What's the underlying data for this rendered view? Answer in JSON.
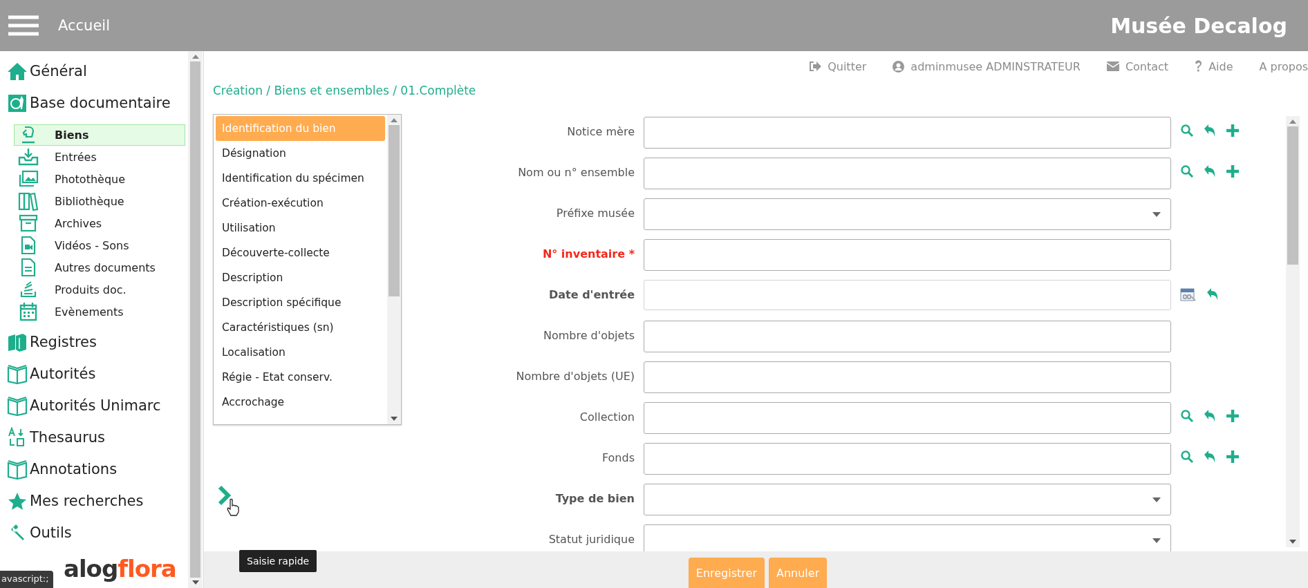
{
  "header": {
    "title": "Accueil",
    "brand": "Musée Decalog"
  },
  "top_links": [
    {
      "kind": "logout",
      "label": "Quitter"
    },
    {
      "kind": "user",
      "label": "adminmusee ADMINSTRATEUR"
    },
    {
      "kind": "mail",
      "label": "Contact"
    },
    {
      "kind": "help",
      "label": "Aide"
    },
    {
      "kind": "plain",
      "label": "A propos"
    }
  ],
  "sidebar": {
    "items": [
      {
        "label": "Général",
        "selected": false
      },
      {
        "label": "Base documentaire",
        "selected": false,
        "children": [
          {
            "label": "Biens",
            "selected": true
          },
          {
            "label": "Entrées",
            "selected": false
          },
          {
            "label": "Photothèque",
            "selected": false
          },
          {
            "label": "Bibliothèque",
            "selected": false
          },
          {
            "label": "Archives",
            "selected": false
          },
          {
            "label": "Vidéos - Sons",
            "selected": false
          },
          {
            "label": "Autres documents",
            "selected": false
          },
          {
            "label": "Produits doc.",
            "selected": false
          },
          {
            "label": "Evènements",
            "selected": false
          }
        ]
      },
      {
        "label": "Registres",
        "selected": false
      },
      {
        "label": "Autorités",
        "selected": false
      },
      {
        "label": "Autorités Unimarc",
        "selected": false
      },
      {
        "label": "Thesaurus",
        "selected": false
      },
      {
        "label": "Annotations",
        "selected": false
      },
      {
        "label": "Mes recherches",
        "selected": false
      },
      {
        "label": "Outils",
        "selected": false
      }
    ],
    "logo": [
      "alog",
      "flora"
    ]
  },
  "status_tip": "avascript:;",
  "breadcrumb": "Création / Biens et ensembles / 01.Complète",
  "sections": [
    {
      "label": "Identification du bien",
      "selected": true
    },
    {
      "label": "Désignation",
      "selected": false
    },
    {
      "label": "Identification du spécimen",
      "selected": false
    },
    {
      "label": "Création-exécution",
      "selected": false
    },
    {
      "label": "Utilisation",
      "selected": false
    },
    {
      "label": "Découverte-collecte",
      "selected": false
    },
    {
      "label": "Description",
      "selected": false
    },
    {
      "label": "Description spécifique",
      "selected": false
    },
    {
      "label": "Caractéristiques (sn)",
      "selected": false
    },
    {
      "label": "Localisation",
      "selected": false
    },
    {
      "label": "Régie - Etat conserv.",
      "selected": false
    },
    {
      "label": "Accrochage",
      "selected": false
    }
  ],
  "fields": [
    {
      "label": "Notice mère",
      "kind": "lookup",
      "required": false,
      "highlighted": false
    },
    {
      "label": "Nom ou n° ensemble",
      "kind": "lookup",
      "required": false,
      "highlighted": false
    },
    {
      "label": "Préfixe musée",
      "kind": "select",
      "required": false,
      "highlighted": false
    },
    {
      "label": "N° inventaire *",
      "kind": "text",
      "required": true,
      "highlighted": true
    },
    {
      "label": "Date d'entrée",
      "kind": "date",
      "required": false,
      "highlighted": true
    },
    {
      "label": "Nombre d'objets",
      "kind": "text",
      "required": false,
      "highlighted": false
    },
    {
      "label": "Nombre d'objets (UE)",
      "kind": "text",
      "required": false,
      "highlighted": false
    },
    {
      "label": "Collection",
      "kind": "lookup",
      "required": false,
      "highlighted": false
    },
    {
      "label": "Fonds",
      "kind": "lookup",
      "required": false,
      "highlighted": false
    },
    {
      "label": "Type de bien",
      "kind": "select",
      "required": false,
      "highlighted": true
    },
    {
      "label": "Statut juridique",
      "kind": "select",
      "required": false,
      "highlighted": false
    }
  ],
  "quick_entry": {
    "tooltip": "Saisie rapide"
  },
  "buttons": [
    "Enregistrer",
    "Annuler"
  ]
}
